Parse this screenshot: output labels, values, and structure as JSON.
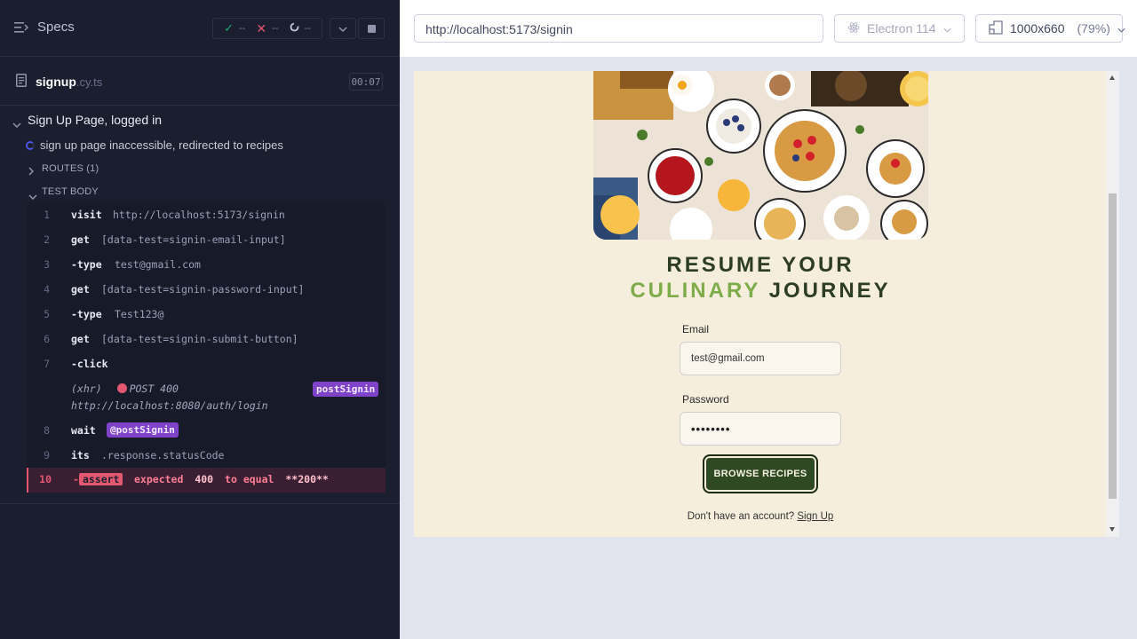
{
  "reporter": {
    "specs_label": "Specs",
    "stats": {
      "passed": "--",
      "failed": "--",
      "pending": "--"
    },
    "file": {
      "name": "signup",
      "ext": ".cy.ts",
      "duration": "00:07"
    },
    "suite_title": "Sign Up Page, logged in",
    "test_title": "sign up page inaccessible, redirected to recipes",
    "routes_label": "ROUTES (1)",
    "test_body_label": "TEST BODY",
    "commands": [
      {
        "num": "1",
        "name": "visit",
        "message": "http://localhost:5173/signin"
      },
      {
        "num": "2",
        "name": "get",
        "message": "[data-test=signin-email-input]"
      },
      {
        "num": "3",
        "name": "-type",
        "message": "test@gmail.com"
      },
      {
        "num": "4",
        "name": "get",
        "message": "[data-test=signin-password-input]"
      },
      {
        "num": "5",
        "name": "-type",
        "message": "Test123@"
      },
      {
        "num": "6",
        "name": "get",
        "message": "[data-test=signin-submit-button]"
      },
      {
        "num": "7",
        "name": "-click",
        "message": ""
      },
      {
        "num": "8",
        "name": "wait",
        "message": "@postSignin"
      },
      {
        "num": "9",
        "name": "its",
        "message": ".response.statusCode"
      },
      {
        "num": "10",
        "name": "-",
        "message": "assert"
      }
    ],
    "xhr": {
      "type": "(xhr)",
      "method": "POST 400",
      "url": "http://localhost:8080/auth/login",
      "alias": "postSignin"
    },
    "assertion": {
      "expected_word": "expected",
      "actual": "400",
      "to_equal": "to equal",
      "expected_value": "**200**"
    }
  },
  "aut_header": {
    "url": "http://localhost:5173/signin",
    "browser": "Electron 114",
    "viewport": "1000x660",
    "scale": "(79%)"
  },
  "app": {
    "heading_line1": "RESUME YOUR",
    "heading_accent": "CULINARY",
    "heading_rest": "JOURNEY",
    "email_label": "Email",
    "email_value": "test@gmail.com",
    "password_label": "Password",
    "password_value": "••••••••",
    "submit_label": "BROWSE RECIPES",
    "signup_prompt": "Don't have an account?",
    "signup_link": "Sign Up"
  },
  "colors": {
    "reporter_bg": "#1b1e2e",
    "app_bg": "#f6eedd",
    "brand_green": "#2f4a22",
    "accent_green": "#7fac4a",
    "error_red": "#e45770",
    "alias_purple": "#7f43c9"
  }
}
